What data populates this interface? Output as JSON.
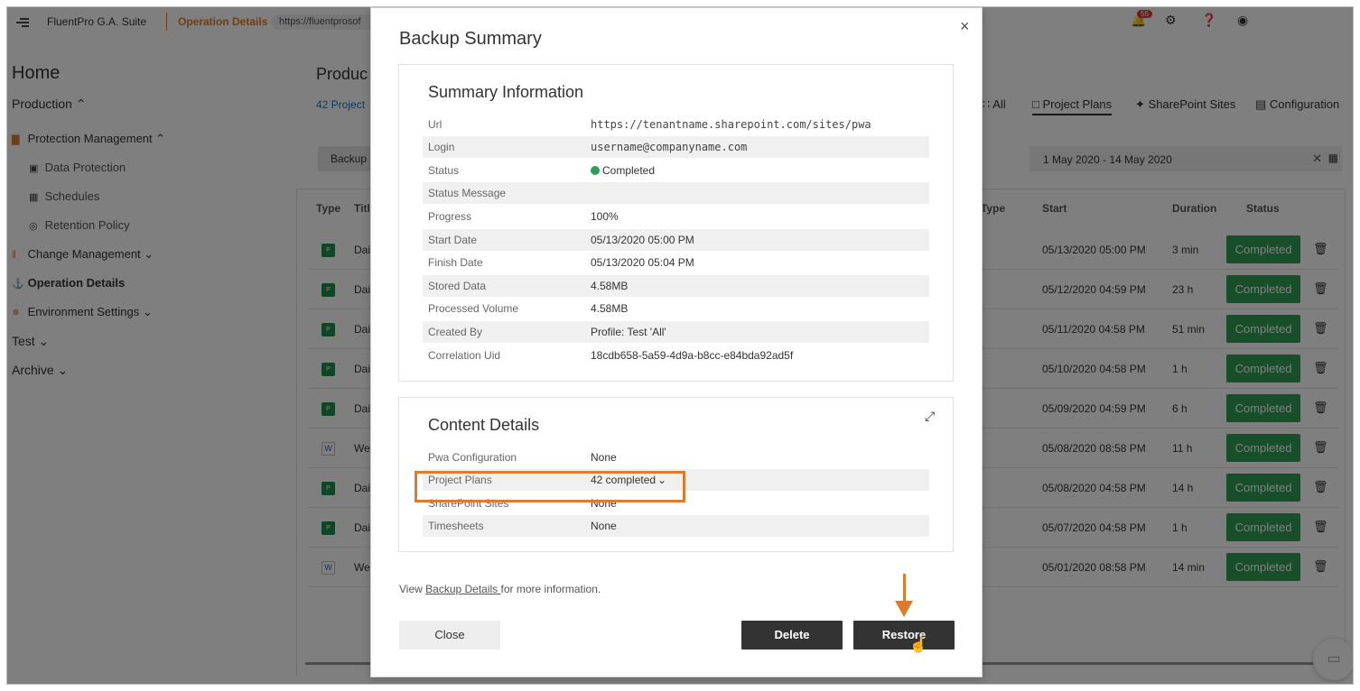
{
  "app": {
    "suite_name": "FluentPro G.A. Suite",
    "section": "Operation Details",
    "url_fragment": "https://fluentprosof",
    "notification_count": "55"
  },
  "sidebar": {
    "home": "Home",
    "items": [
      {
        "label": "Production",
        "level": 0,
        "expanded": true
      },
      {
        "label": "Protection Management",
        "level": 1,
        "expanded": true
      },
      {
        "label": "Data Protection",
        "level": 2
      },
      {
        "label": "Schedules",
        "level": 2
      },
      {
        "label": "Retention Policy",
        "level": 2
      },
      {
        "label": "Change Management",
        "level": 1,
        "expanded": false
      },
      {
        "label": "Operation Details",
        "level": 1,
        "active": true
      },
      {
        "label": "Environment Settings",
        "level": 1,
        "expanded": false
      },
      {
        "label": "Test",
        "level": 0,
        "expanded": false
      },
      {
        "label": "Archive",
        "level": 0,
        "expanded": false
      }
    ]
  },
  "background": {
    "page_title": "Produc",
    "projects_link": "42 Project",
    "tabs": [
      "All",
      "Project Plans",
      "SharePoint Sites",
      "Configuration"
    ],
    "active_tab": "Project Plans",
    "backup_btn": "Backup",
    "date_range": "1 May 2020 - 14 May 2020",
    "columns": [
      "Type",
      "Titl",
      "Type",
      "Start",
      "Duration",
      "Status"
    ],
    "rows": [
      {
        "type": "P",
        "title": "Dai",
        "start": "05/13/2020 05:00 PM",
        "duration": "3 min",
        "status": "Completed"
      },
      {
        "type": "P",
        "title": "Dai",
        "start": "05/12/2020 04:59 PM",
        "duration": "23 h",
        "status": "Completed"
      },
      {
        "type": "P",
        "title": "Dai",
        "start": "05/11/2020 04:58 PM",
        "duration": "51 min",
        "status": "Completed"
      },
      {
        "type": "P",
        "title": "Dai",
        "start": "05/10/2020 04:58 PM",
        "duration": "1 h",
        "status": "Completed"
      },
      {
        "type": "P",
        "title": "Dai",
        "start": "05/09/2020 04:59 PM",
        "duration": "6 h",
        "status": "Completed"
      },
      {
        "type": "W",
        "title": "We",
        "start": "05/08/2020 08:58 PM",
        "duration": "11 h",
        "status": "Completed"
      },
      {
        "type": "P",
        "title": "Dai",
        "start": "05/08/2020 04:58 PM",
        "duration": "14 h",
        "status": "Completed"
      },
      {
        "type": "P",
        "title": "Dai",
        "start": "05/07/2020 04:58 PM",
        "duration": "1 h",
        "status": "Completed"
      },
      {
        "type": "W",
        "title": "We",
        "start": "05/01/2020 08:58 PM",
        "duration": "14 min",
        "status": "Completed"
      }
    ]
  },
  "modal": {
    "title": "Backup Summary",
    "summary": {
      "heading": "Summary Information",
      "fields": [
        {
          "key": "Url",
          "value": "https://tenantname.sharepoint.com/sites/pwa"
        },
        {
          "key": "Login",
          "value": "username@companyname.com"
        },
        {
          "key": "Status",
          "value": "Completed"
        },
        {
          "key": "Status Message",
          "value": ""
        },
        {
          "key": "Progress",
          "value": "100%"
        },
        {
          "key": "Start Date",
          "value": "05/13/2020 05:00 PM"
        },
        {
          "key": "Finish Date",
          "value": "05/13/2020 05:04 PM"
        },
        {
          "key": "Stored Data",
          "value": "4.58MB"
        },
        {
          "key": "Processed Volume",
          "value": "4.58MB"
        },
        {
          "key": "Created By",
          "value": "Profile: Test 'All'"
        },
        {
          "key": "Correlation Uid",
          "value": "18cdb658-5a59-4d9a-b8cc-e84bda92ad5f"
        }
      ]
    },
    "content": {
      "heading": "Content Details",
      "fields": [
        {
          "key": "Pwa Configuration",
          "value": "None"
        },
        {
          "key": "Project Plans",
          "value": "42 completed"
        },
        {
          "key": "SharePoint Sites",
          "value": "None"
        },
        {
          "key": "Timesheets",
          "value": "None"
        }
      ]
    },
    "footer": {
      "prefix": "View ",
      "link": "Backup Details ",
      "suffix": "for more information."
    },
    "buttons": {
      "close": "Close",
      "delete": "Delete",
      "restore": "Restore"
    }
  },
  "colors": {
    "accent": "#e07b2d",
    "success": "#2e9e56",
    "dark_button": "#333333"
  }
}
